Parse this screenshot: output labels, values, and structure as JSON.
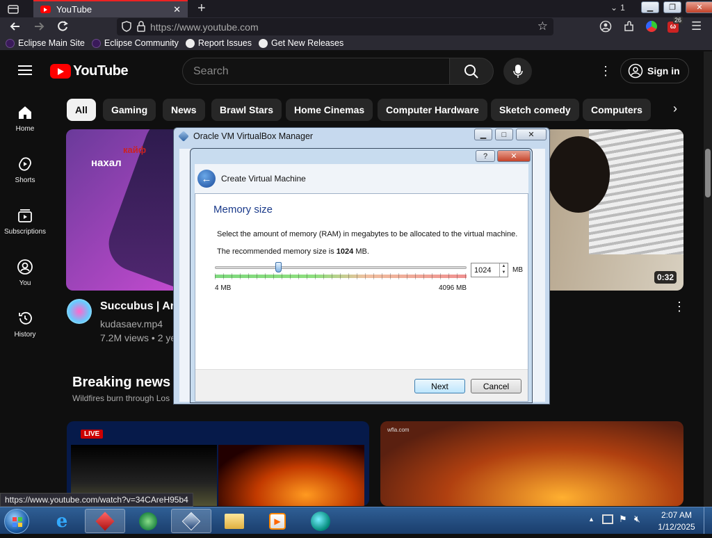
{
  "browser": {
    "tab_title": "YouTube",
    "tab_count": "1",
    "url": "https://www.youtube.com",
    "extension_badge": "26",
    "bookmarks": [
      "Eclipse Main Site",
      "Eclipse Community",
      "Report Issues",
      "Get New Releases"
    ],
    "status_url": "https://www.youtube.com/watch?v=34CAreH95b4"
  },
  "youtube": {
    "logo": "YouTube",
    "search_placeholder": "Search",
    "sign_in": "Sign in",
    "chips": [
      "All",
      "Gaming",
      "News",
      "Brawl Stars",
      "Home Cinemas",
      "Computer Hardware",
      "Sketch comedy",
      "Computers"
    ],
    "sidebar": [
      {
        "label": "Home",
        "icon": "home-icon"
      },
      {
        "label": "Shorts",
        "icon": "shorts-icon"
      },
      {
        "label": "Subscriptions",
        "icon": "subscriptions-icon"
      },
      {
        "label": "You",
        "icon": "you-icon"
      },
      {
        "label": "History",
        "icon": "history-icon"
      }
    ],
    "video1": {
      "title": "Succubus | Ani",
      "channel": "kudasaev.mp4",
      "meta": "7.2M views • 2 ye",
      "thumb_text1": "кайф",
      "thumb_text2": "нахал"
    },
    "video2": {
      "duration": "0:32"
    },
    "section": {
      "title": "Breaking news",
      "subtitle": "Wildfires burn through Los"
    },
    "live_badge": "LIVE",
    "news2_watermark": "wfla.com"
  },
  "vbox": {
    "manager_title": "Oracle VM VirtualBox Manager",
    "wizard_title": "Create Virtual Machine",
    "section_title": "Memory size",
    "description": "Select the amount of memory (RAM) in megabytes to be allocated to the virtual machine.",
    "recommend_prefix": "The recommended memory size is ",
    "recommend_value": "1024",
    "recommend_suffix": " MB.",
    "memory_value": "1024",
    "unit": "MB",
    "min_label": "4 MB",
    "max_label": "4096 MB",
    "slider_fraction": 0.25,
    "next": "Next",
    "cancel": "Cancel",
    "help": "?",
    "close": "✕"
  },
  "taskbar": {
    "time": "2:07 AM",
    "date": "1/12/2025"
  },
  "colors": {
    "yt_red": "#ff0000",
    "accent": "#3d7fd1",
    "taskbar": "#1f4a7f"
  }
}
